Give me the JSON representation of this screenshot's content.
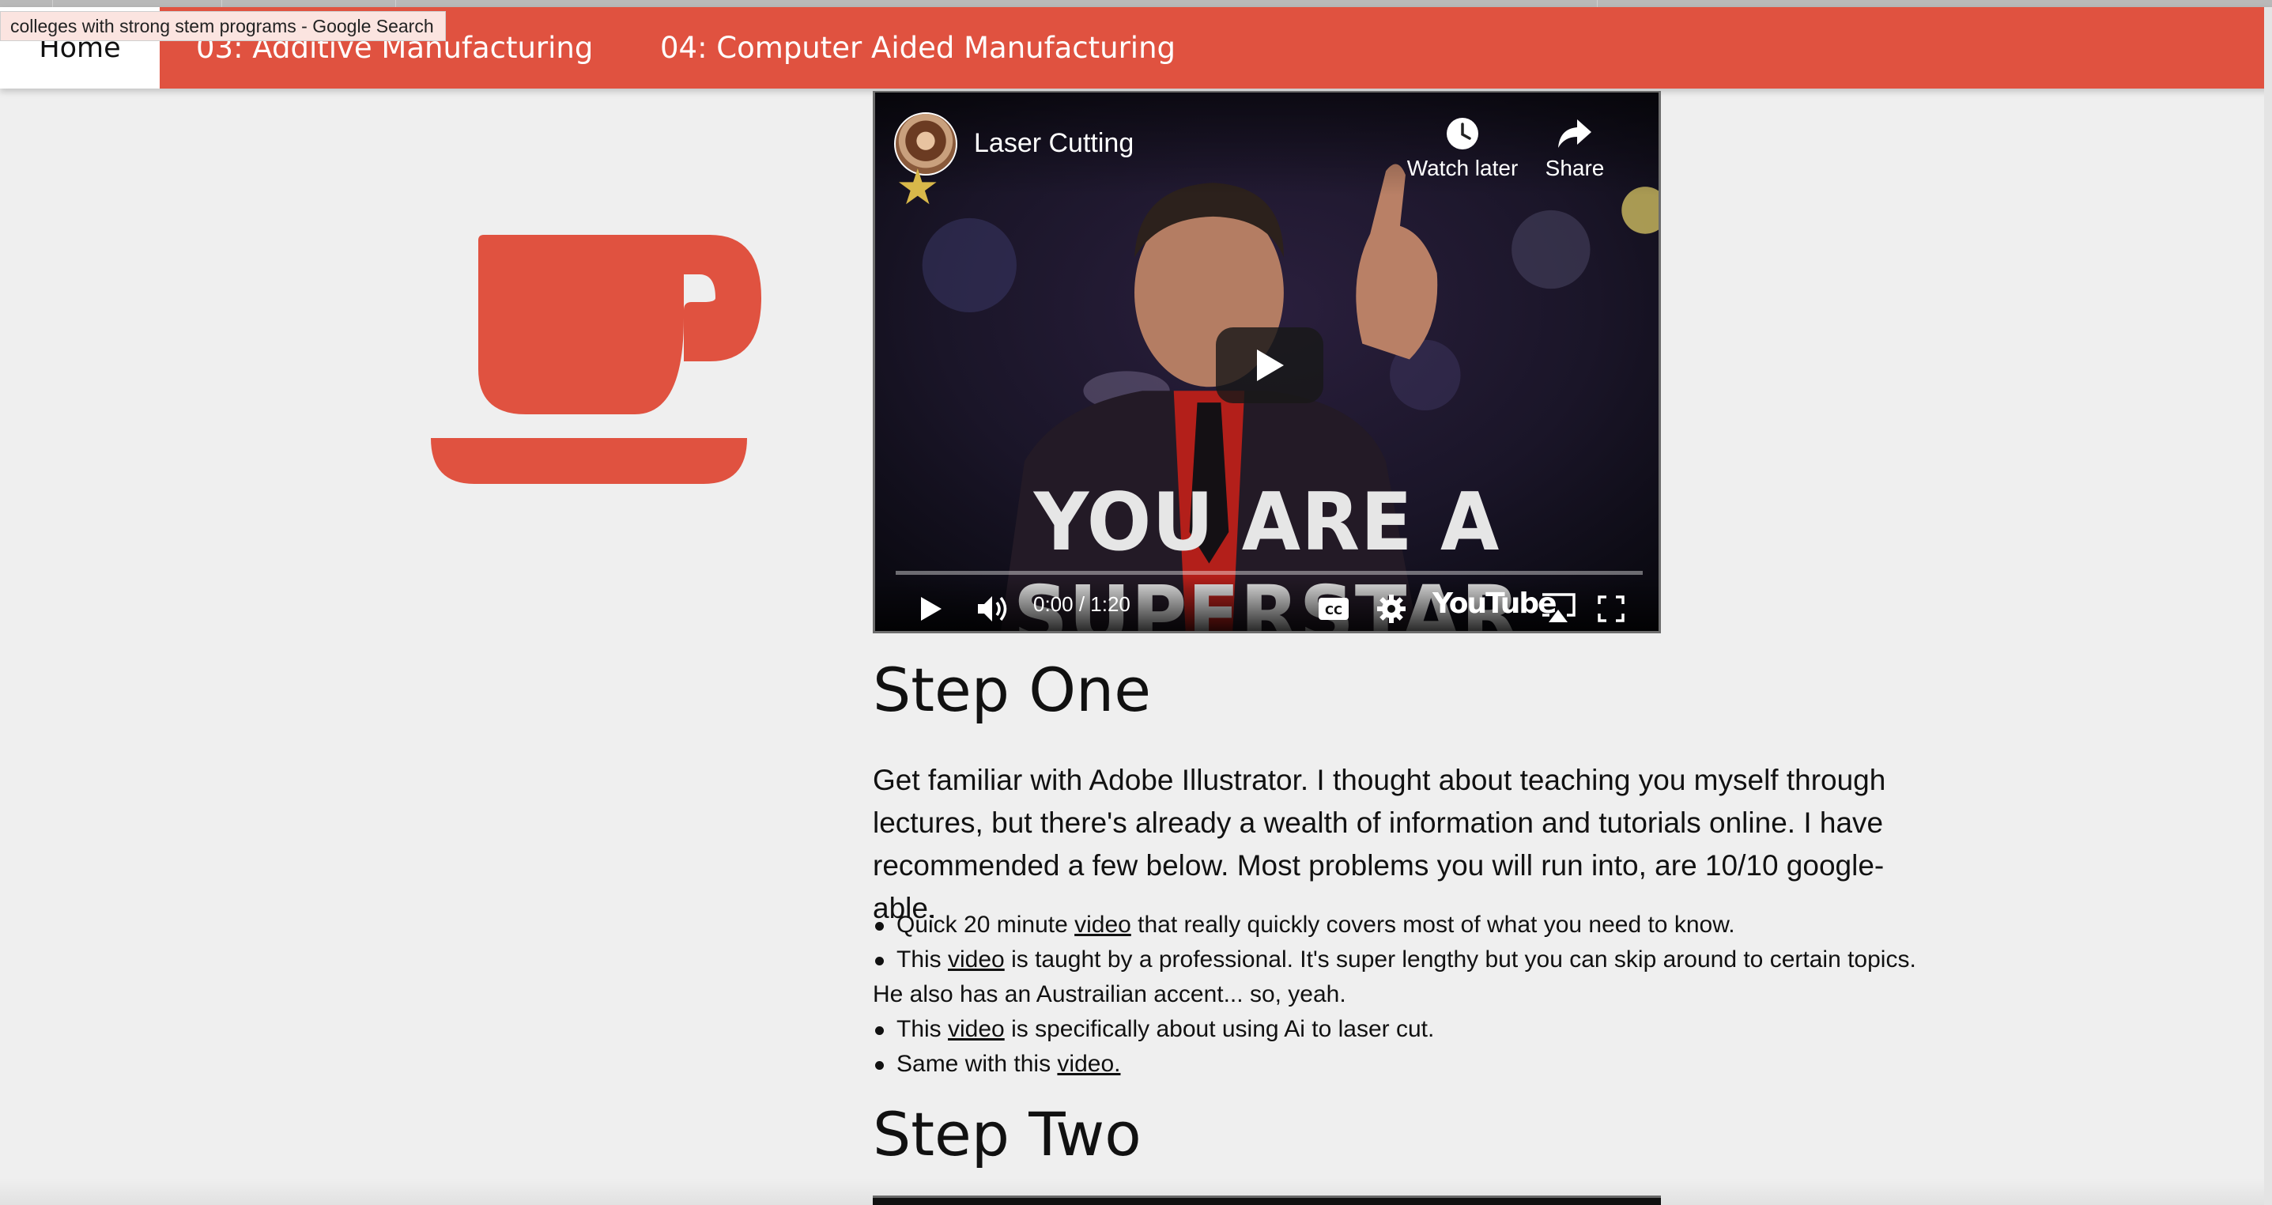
{
  "tooltip": "colleges with strong stem programs - Google Search",
  "nav": {
    "home": "Home",
    "items": [
      "03: Additive Manufacturing",
      "04: Computer Aided Manufacturing"
    ]
  },
  "colors": {
    "accent": "#e05240",
    "background": "#efefef"
  },
  "video": {
    "title": "Laser Cutting",
    "watch_later": "Watch later",
    "share": "Share",
    "caption": "YOU ARE A SUPERSTAR",
    "time": "0:00 / 1:20",
    "logo": "YouTube",
    "icons": [
      "clock-icon",
      "share-icon",
      "play-icon",
      "volume-icon",
      "cc-icon",
      "settings-icon",
      "airplay-icon",
      "fullscreen-icon"
    ]
  },
  "step_one": {
    "heading": "Step One",
    "intro": "Get familiar with Adobe Illustrator. I thought about teaching you myself through lectures, but there's already a wealth of information and tutorials online. I have recommended a few below. Most problems you will run into, are 10/10 google-able.",
    "bullets": [
      {
        "before": "Quick 20 minute ",
        "link": "video",
        "after": " that really quickly covers most of what you need to know."
      },
      {
        "before": "This ",
        "link": "video",
        "after": " is taught by a professional. It's super lengthy but you can skip around to certain topics."
      },
      {
        "continuation": "He also has an Austrailian accent... so, yeah."
      },
      {
        "before": "This ",
        "link": "video",
        "after": " is specifically about using Ai to laser cut."
      },
      {
        "before": "Same with this ",
        "link": "video.",
        "after": ""
      }
    ]
  },
  "step_two": {
    "heading": "Step Two"
  }
}
